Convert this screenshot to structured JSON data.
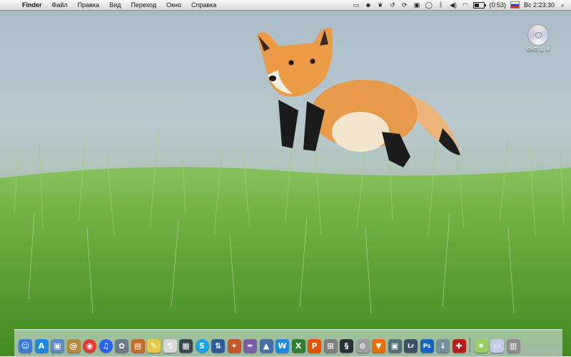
{
  "menubar": {
    "apple_glyph": "",
    "app_name": "Finder",
    "menus": [
      "Файл",
      "Правка",
      "Вид",
      "Переход",
      "Окно",
      "Справка"
    ],
    "battery_time": "(0:53)",
    "battery_level": 0.5,
    "clock": "Вс 2:23:30",
    "status_icons": [
      "window-icon",
      "growl-icon",
      "paw-icon",
      "time-machine-icon",
      "sync-icon",
      "display-icon",
      "chat-icon",
      "bluetooth-icon",
      "volume-icon",
      "wifi-icon",
      "battery-icon",
      "russian-flag-icon"
    ]
  },
  "desktop": {
    "dvd_label": "DVD_L_4"
  },
  "dock": {
    "items": [
      {
        "name": "finder",
        "glyph": "☺",
        "color": "#3a7bd5"
      },
      {
        "name": "app-store",
        "glyph": "A",
        "color": "#1e88e5"
      },
      {
        "name": "preview",
        "glyph": "▣",
        "color": "#5b8cc7"
      },
      {
        "name": "address-book",
        "glyph": "@",
        "color": "#b8893c"
      },
      {
        "name": "chrome",
        "glyph": "◉",
        "color": "#e53935"
      },
      {
        "name": "itunes",
        "glyph": "♫",
        "color": "#2962ff"
      },
      {
        "name": "iphoto",
        "glyph": "✿",
        "color": "#6d7a8a"
      },
      {
        "name": "photo-booth",
        "glyph": "▤",
        "color": "#c96a2b"
      },
      {
        "name": "stickies",
        "glyph": "✎",
        "color": "#e8c84a"
      },
      {
        "name": "textedit",
        "glyph": "¶",
        "color": "#d9d9d9"
      },
      {
        "name": "mission-control",
        "glyph": "▦",
        "color": "#37474f"
      },
      {
        "name": "skype",
        "glyph": "S",
        "color": "#1aa3e8"
      },
      {
        "name": "transmit",
        "glyph": "⇅",
        "color": "#2e5c9a"
      },
      {
        "name": "coconut",
        "glyph": "✦",
        "color": "#c8542a"
      },
      {
        "name": "pages",
        "glyph": "✒",
        "color": "#7b5ea7"
      },
      {
        "name": "keynote",
        "glyph": "▲",
        "color": "#4a6fa5"
      },
      {
        "name": "word",
        "glyph": "W",
        "color": "#1e88e5"
      },
      {
        "name": "excel",
        "glyph": "X",
        "color": "#2e7d32"
      },
      {
        "name": "powerpoint",
        "glyph": "P",
        "color": "#e65100"
      },
      {
        "name": "vmware",
        "glyph": "⊞",
        "color": "#7d7d7d"
      },
      {
        "name": "smart-sync",
        "glyph": "§",
        "color": "#263238"
      },
      {
        "name": "disk-utility",
        "glyph": "⊙",
        "color": "#9e9e9e"
      },
      {
        "name": "vlc",
        "glyph": "▼",
        "color": "#ef6c00"
      },
      {
        "name": "image-capture",
        "glyph": "▣",
        "color": "#546e7a"
      },
      {
        "name": "lightroom",
        "glyph": "Lr",
        "color": "#3d4f63"
      },
      {
        "name": "photoshop",
        "glyph": "Ps",
        "color": "#1565c0"
      },
      {
        "name": "downloader",
        "glyph": "↓",
        "color": "#78909c"
      },
      {
        "name": "utility",
        "glyph": "✚",
        "color": "#b71c1c"
      },
      {
        "name": "downloads-stack",
        "glyph": "✷",
        "color": "#9ccc65"
      },
      {
        "name": "documents-stack",
        "glyph": "▭",
        "color": "#c5cae9"
      },
      {
        "name": "trash",
        "glyph": "▥",
        "color": "#8d8d8d"
      }
    ]
  }
}
